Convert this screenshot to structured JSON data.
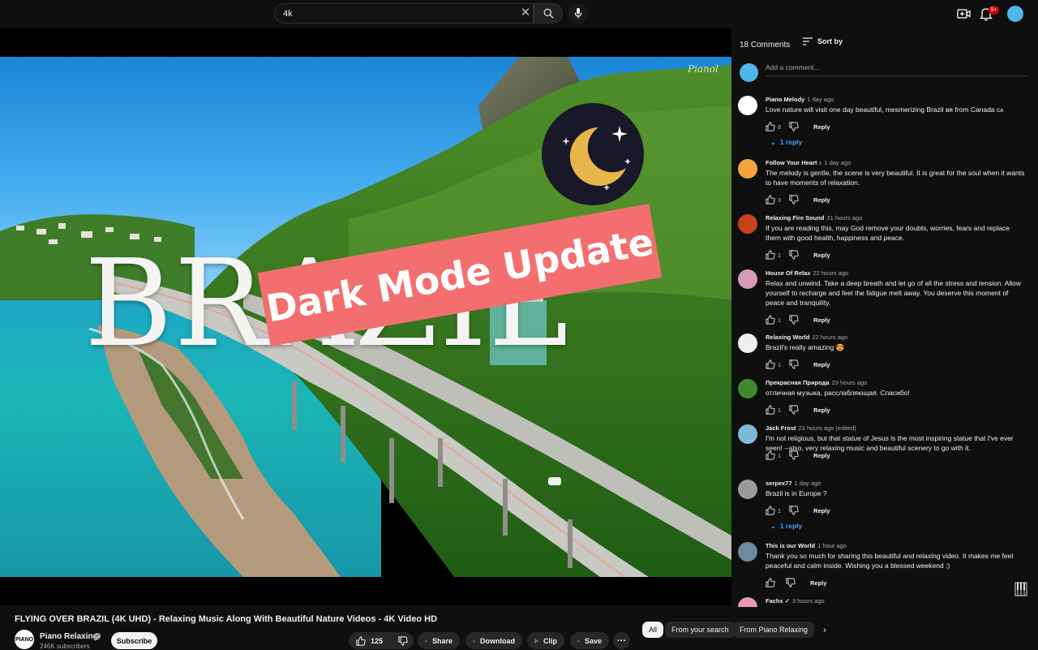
{
  "search": {
    "query": "4k"
  },
  "notifications": {
    "badge": "9+"
  },
  "video": {
    "title": "FLYING OVER BRAZIL (4K UHD) - Relaxing Music Along With Beautiful Nature Videos - 4K Video HD",
    "overlay_title": "BRAZIL",
    "banner_text": "Dark Mode Update"
  },
  "channel": {
    "name": "Piano Relaxing",
    "subscribers": "246K subscribers",
    "avatar_text": "PIANO",
    "subscribe_label": "Subscribe"
  },
  "actions": {
    "likes": "125",
    "share": "Share",
    "download": "Download",
    "clip": "Clip",
    "save": "Save",
    "more": "···"
  },
  "chips": {
    "all": "All",
    "from_search": "From your search",
    "from_channel": "From Piano Relaxing"
  },
  "comments": {
    "count_label": "18 Comments",
    "sort_label": "Sort by",
    "add_placeholder": "Add a comment...",
    "items": [
      {
        "author": "Piano Melody",
        "time": "1 day ago",
        "text": "Love nature will visit one day beautiful, mesmerizing Brazil ʙʀ  from Canada ᴄᴀ",
        "likes": "8",
        "reply": "Reply",
        "replies": "1 reply",
        "avatar_color": "#ffffff"
      },
      {
        "author": "Follow Your Heart ♪",
        "time": "1 day ago",
        "text": "The melody is gentle, the scene is very beautiful. It is great for the soul when it wants to have moments of relaxation.",
        "likes": "3",
        "reply": "Reply",
        "avatar_color": "#f3a53c"
      },
      {
        "author": "Relaxing Fire Sound",
        "time": "21 hours ago",
        "text": "If you are reading this, may God remove your doubts, worries, fears and replace them with good health, happiness and peace.",
        "likes": "1",
        "reply": "Reply",
        "avatar_color": "#c7431c"
      },
      {
        "author": "House Of Relax",
        "time": "22 hours ago",
        "text": "Relax and unwind. Take a deep breath and let go of all the stress and tension. Allow yourself to recharge and feel the fatigue melt away. You deserve this moment of peace and tranquility.",
        "likes": "1",
        "reply": "Reply",
        "avatar_color": "#d59ab8"
      },
      {
        "author": "Relaxing World",
        "time": "22 hours ago",
        "text": "Brazil's really amazing 😍",
        "likes": "1",
        "reply": "Reply",
        "avatar_color": "#eeeeee"
      },
      {
        "author": "Прекрасная Природа",
        "time": "23 hours ago",
        "text": "отличная музыка, расслабляющая. Спасибо!",
        "likes": "1",
        "reply": "Reply",
        "avatar_color": "#3f8a2c"
      },
      {
        "author": "Jack Frost",
        "time": "23 hours ago (edited)",
        "text": "I'm not religious, but that statue of Jesus is the most inspiring statue that I've ever seen! --also, very relaxing music and beautiful scenery to go with it.",
        "likes": "1",
        "reply": "Reply",
        "avatar_color": "#7fb9d8"
      },
      {
        "author": "serpex77",
        "time": "1 day ago",
        "text": "Brazil is in Europe ?",
        "likes": "1",
        "reply": "Reply",
        "replies": "1 reply",
        "avatar_color": "#9a9a9a"
      },
      {
        "author": "This is our World",
        "time": "1 hour ago",
        "text": "Thank you so much for sharing this beautiful and relaxing video. It makes me feel peaceful and calm inside. Wishing you a blessed weekend :)",
        "likes": "",
        "reply": "Reply",
        "avatar_color": "#6d8aa3"
      },
      {
        "author": "Fachx ✓",
        "time": "3 hours ago",
        "text": "",
        "likes": "",
        "reply": "",
        "avatar_color": "#e79ab0"
      }
    ]
  }
}
